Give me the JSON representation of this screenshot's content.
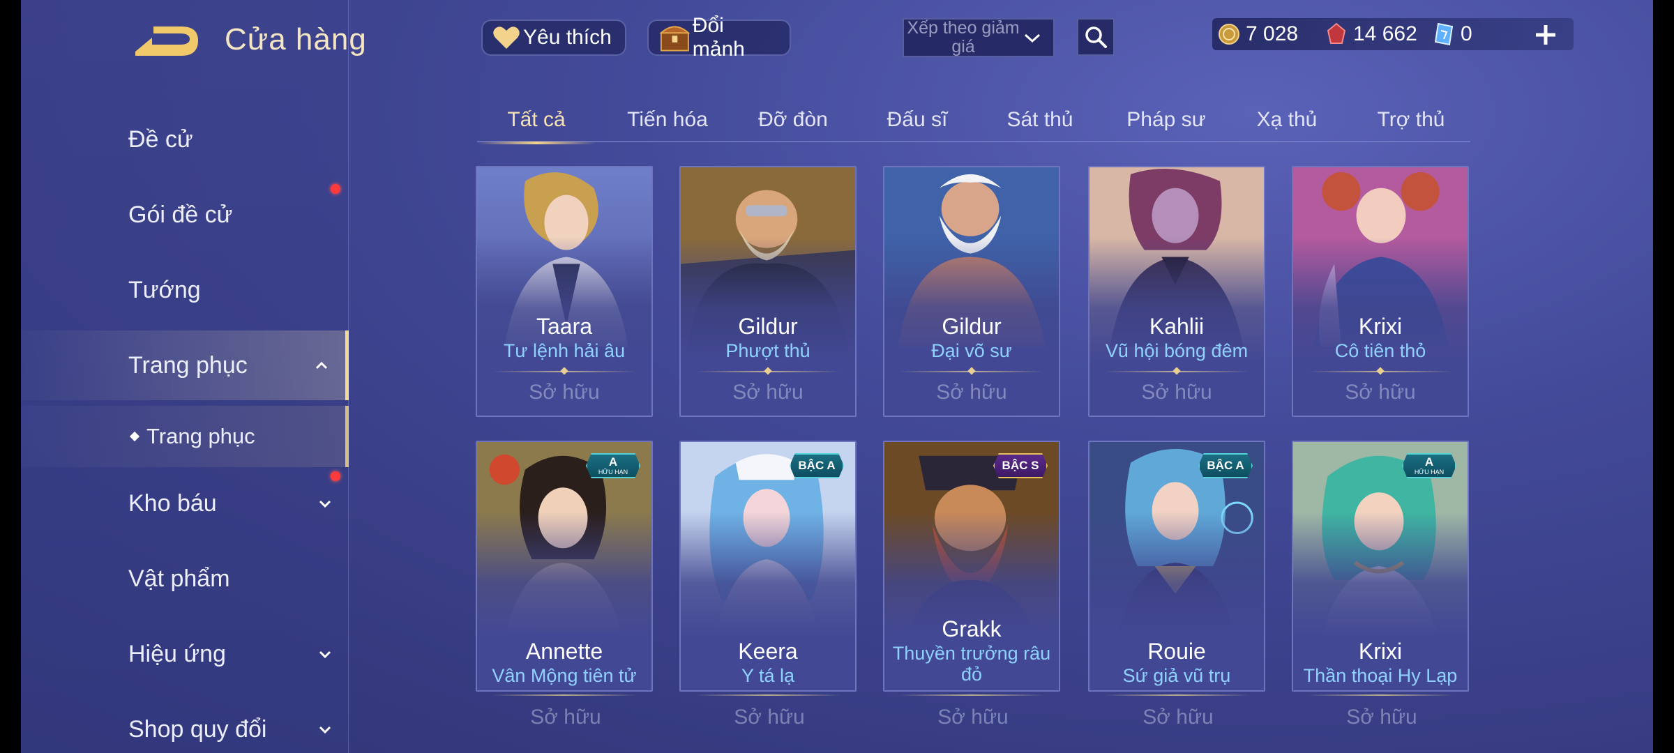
{
  "header": {
    "title": "Cửa hàng",
    "favorites_label": "Yêu thích",
    "exchange_label": "Đổi mảnh",
    "sort_placeholder": "Xếp theo giảm giá"
  },
  "currencies": [
    {
      "icon": "gold-coin-icon",
      "value": "7 028"
    },
    {
      "icon": "red-gem-icon",
      "value": "14 662"
    },
    {
      "icon": "voucher-icon",
      "value": "0"
    }
  ],
  "sidebar": {
    "items": [
      {
        "label": "Đề cử",
        "has_dot": false,
        "chevron": "none"
      },
      {
        "label": "Gói đề cử",
        "has_dot": true,
        "chevron": "none"
      },
      {
        "label": "Tướng",
        "has_dot": false,
        "chevron": "none"
      },
      {
        "label": "Trang phục",
        "has_dot": false,
        "chevron": "up",
        "active": true
      },
      {
        "label": "Kho báu",
        "has_dot": true,
        "chevron": "down"
      },
      {
        "label": "Vật phẩm",
        "has_dot": false,
        "chevron": "none"
      },
      {
        "label": "Hiệu ứng",
        "has_dot": false,
        "chevron": "down"
      },
      {
        "label": "Shop quy đổi",
        "has_dot": false,
        "chevron": "down"
      }
    ],
    "sub_item": "Trang phục"
  },
  "tabs": [
    "Tất cả",
    "Tiến hóa",
    "Đỡ đòn",
    "Đấu sĩ",
    "Sát thủ",
    "Pháp sư",
    "Xạ thủ",
    "Trợ thủ"
  ],
  "active_tab": 0,
  "cards": [
    {
      "hero": "Taara",
      "skin": "Tư lệnh hải âu",
      "status": "Sở hữu",
      "badge": null
    },
    {
      "hero": "Gildur",
      "skin": "Phượt thủ",
      "status": "Sở hữu",
      "badge": null
    },
    {
      "hero": "Gildur",
      "skin": "Đại võ sư",
      "status": "Sở hữu",
      "badge": null
    },
    {
      "hero": "Kahlii",
      "skin": "Vũ hội bóng đêm",
      "status": "Sở hữu",
      "badge": null
    },
    {
      "hero": "Krixi",
      "skin": "Cô tiên thỏ",
      "status": "Sở hữu",
      "badge": null
    },
    {
      "hero": "Annette",
      "skin": "Vân Mộng tiên tử",
      "status": "Sở hữu",
      "badge": {
        "top": "A",
        "sub": "HỮU HẠN"
      }
    },
    {
      "hero": "Keera",
      "skin": "Y tá lạ",
      "status": "Sở hữu",
      "badge": {
        "top": "BẬC A",
        "sub": ""
      }
    },
    {
      "hero": "Grakk",
      "skin": "Thuyền trưởng râu đỏ",
      "status": "Sở hữu",
      "badge": {
        "top": "BẬC S",
        "sub": ""
      }
    },
    {
      "hero": "Rouie",
      "skin": "Sứ giả vũ trụ",
      "status": "Sở hữu",
      "badge": {
        "top": "BẬC A",
        "sub": ""
      }
    },
    {
      "hero": "Krixi",
      "skin": "Thần thoại Hy Lạp",
      "status": "Sở hữu",
      "badge": {
        "top": "A",
        "sub": "HỮU HẠN"
      }
    }
  ],
  "colors": {
    "accent_gold": "#f3d28c",
    "skin_name_blue": "#8fd1ff",
    "notification_red": "#ff3a3a",
    "background": "#434a99"
  }
}
